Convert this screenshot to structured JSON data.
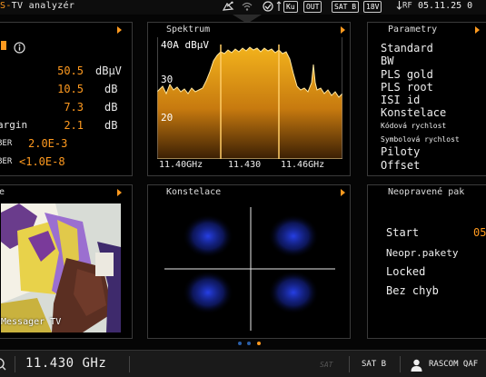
{
  "statusbar": {
    "title_tail": "TV analyzér",
    "badges": [
      "Ku",
      "OUT",
      "SAT B",
      "18V"
    ],
    "rf_label": "RF",
    "datetime": "05.11.25 0"
  },
  "measurements": {
    "level_value": "50.5",
    "level_unit": "dBμV",
    "row2_value": "10.5",
    "row2_unit": "dB",
    "row3_value": "7.3",
    "row3_unit": "dB",
    "margin_label": "argin",
    "margin_value": "2.1",
    "margin_unit": "dB",
    "ber1_label": "BER",
    "ber1_value": "2.0E-3",
    "ber2_label": "BER",
    "ber2_value": "<1.0E-8"
  },
  "spectrum": {
    "title": "Spektrum",
    "level_label": "40A dBμV",
    "ticks": [
      "30",
      "20"
    ],
    "freq_left": "11.40GHz",
    "freq_center": "11.430",
    "freq_right": "11.46GHz"
  },
  "parameters": {
    "title": "Parametry",
    "items": [
      "Standard",
      "BW",
      "PLS gold",
      "PLS root",
      "ISI id",
      "Konstelace"
    ],
    "small_items": [
      "Kódová rychlost",
      "Symbolová rychlost"
    ],
    "items_after": [
      "Piloty",
      "Offset"
    ]
  },
  "video": {
    "title_fragment": "e",
    "overlay": "Messager TV"
  },
  "constellation": {
    "title": "Konstelace"
  },
  "packets": {
    "title": "Neopravené pak",
    "items": [
      "Start",
      "Neopr.pakety",
      "Locked",
      "Bez chyb"
    ],
    "start_value": "05"
  },
  "bottom": {
    "frequency": "11.430 GHz",
    "sat_faint": "SAT",
    "sat_band": "SAT B",
    "sat_name": "RASCOM QAF"
  },
  "colors": {
    "accent": "#ff9a1f",
    "spectrum_fill": "#e8a21a",
    "constellation": "#1e3cff"
  }
}
